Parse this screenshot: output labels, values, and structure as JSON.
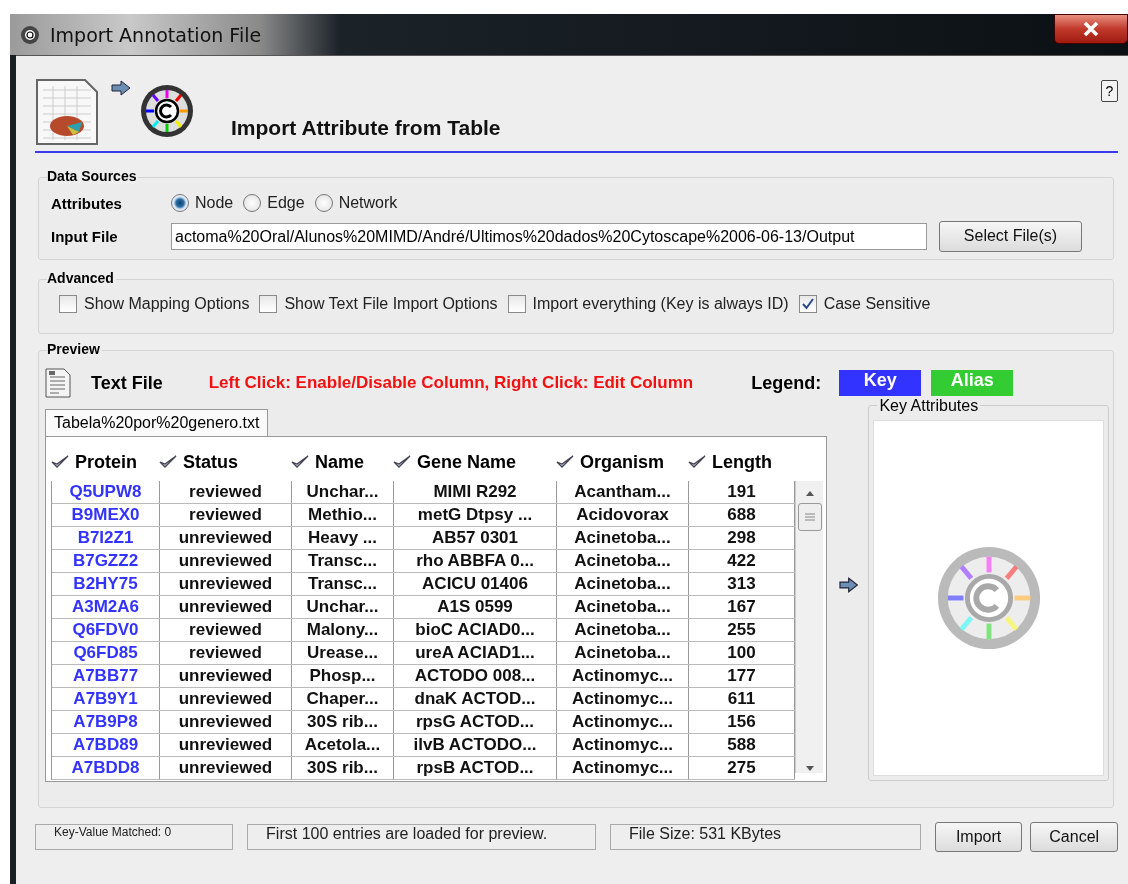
{
  "window": {
    "title": "Import Annotation File"
  },
  "header": {
    "title": "Import Attribute from Table",
    "help_button": "?"
  },
  "data_sources": {
    "label": "Data Sources",
    "attributes_label": "Attributes",
    "options": [
      {
        "label": "Node",
        "selected": true
      },
      {
        "label": "Edge",
        "selected": false
      },
      {
        "label": "Network",
        "selected": false
      }
    ],
    "input_file_label": "Input File",
    "input_file_value": "actoma%20Oral/Alunos%20MIMD/André/Ultimos%20dados%20Cytoscape%2006-06-13/Output",
    "select_button": "Select File(s)"
  },
  "advanced": {
    "label": "Advanced",
    "options": [
      {
        "label": "Show Mapping Options",
        "checked": false
      },
      {
        "label": "Show Text File Import Options",
        "checked": false
      },
      {
        "label": "Import everything (Key is always ID)",
        "checked": false
      },
      {
        "label": "Case Sensitive",
        "checked": true
      }
    ]
  },
  "preview": {
    "label": "Preview",
    "file_label": "Text File",
    "hint": "Left Click: Enable/Disable Column, Right Click: Edit Column",
    "legend_label": "Legend:",
    "legend": [
      {
        "label": "Key",
        "color": "#3333ff"
      },
      {
        "label": "Alias",
        "color": "#33cc33"
      }
    ],
    "tab": {
      "label": "Tabela%20por%20genero.txt",
      "selected": true
    },
    "columns": [
      {
        "label": "Protein",
        "enabled": true,
        "kind": "key"
      },
      {
        "label": "Status",
        "enabled": true,
        "kind": "attribute"
      },
      {
        "label": "Name",
        "enabled": true,
        "kind": "attribute"
      },
      {
        "label": "Gene Name",
        "enabled": true,
        "kind": "attribute"
      },
      {
        "label": "Organism",
        "enabled": true,
        "kind": "attribute"
      },
      {
        "label": "Length",
        "enabled": true,
        "kind": "attribute"
      }
    ],
    "rows": [
      [
        "Q5UPW8",
        "reviewed",
        "Unchar...",
        "MIMI R292",
        "Acantham...",
        "191"
      ],
      [
        "B9MEX0",
        "reviewed",
        "Methio...",
        "metG Dtpsy ...",
        "Acidovorax",
        "688"
      ],
      [
        "B7I2Z1",
        "unreviewed",
        "Heavy ...",
        "AB57 0301",
        "Acinetoba...",
        "298"
      ],
      [
        "B7GZZ2",
        "unreviewed",
        "Transc...",
        "rho ABBFA 0...",
        "Acinetoba...",
        "422"
      ],
      [
        "B2HY75",
        "unreviewed",
        "Transc...",
        "ACICU 01406",
        "Acinetoba...",
        "313"
      ],
      [
        "A3M2A6",
        "unreviewed",
        "Unchar...",
        "A1S 0599",
        "Acinetoba...",
        "167"
      ],
      [
        "Q6FDV0",
        "reviewed",
        "Malony...",
        "bioC ACIAD0...",
        "Acinetoba...",
        "255"
      ],
      [
        "Q6FD85",
        "reviewed",
        "Urease...",
        "ureA ACIAD1...",
        "Acinetoba...",
        "100"
      ],
      [
        "A7BB77",
        "unreviewed",
        "Phosp...",
        "ACTODO 008...",
        "Actinomyc...",
        "177"
      ],
      [
        "A7B9Y1",
        "unreviewed",
        "Chaper...",
        "dnaK ACTOD...",
        "Actinomyc...",
        "611"
      ],
      [
        "A7B9P8",
        "unreviewed",
        "30S rib...",
        "rpsG ACTOD...",
        "Actinomyc...",
        "156"
      ],
      [
        "A7BD89",
        "unreviewed",
        "Acetola...",
        "ilvB ACTODO...",
        "Actinomyc...",
        "588"
      ],
      [
        "A7BDD8",
        "unreviewed",
        "30S rib...",
        "rpsB ACTOD...",
        "Actinomyc...",
        "275"
      ]
    ],
    "key_panel_title": "Key Attributes"
  },
  "status": [
    "Key-Value Matched: 0",
    "First 100 entries are loaded for preview.",
    "File Size: 531 KBytes"
  ],
  "buttons": [
    "Import",
    "Cancel"
  ]
}
